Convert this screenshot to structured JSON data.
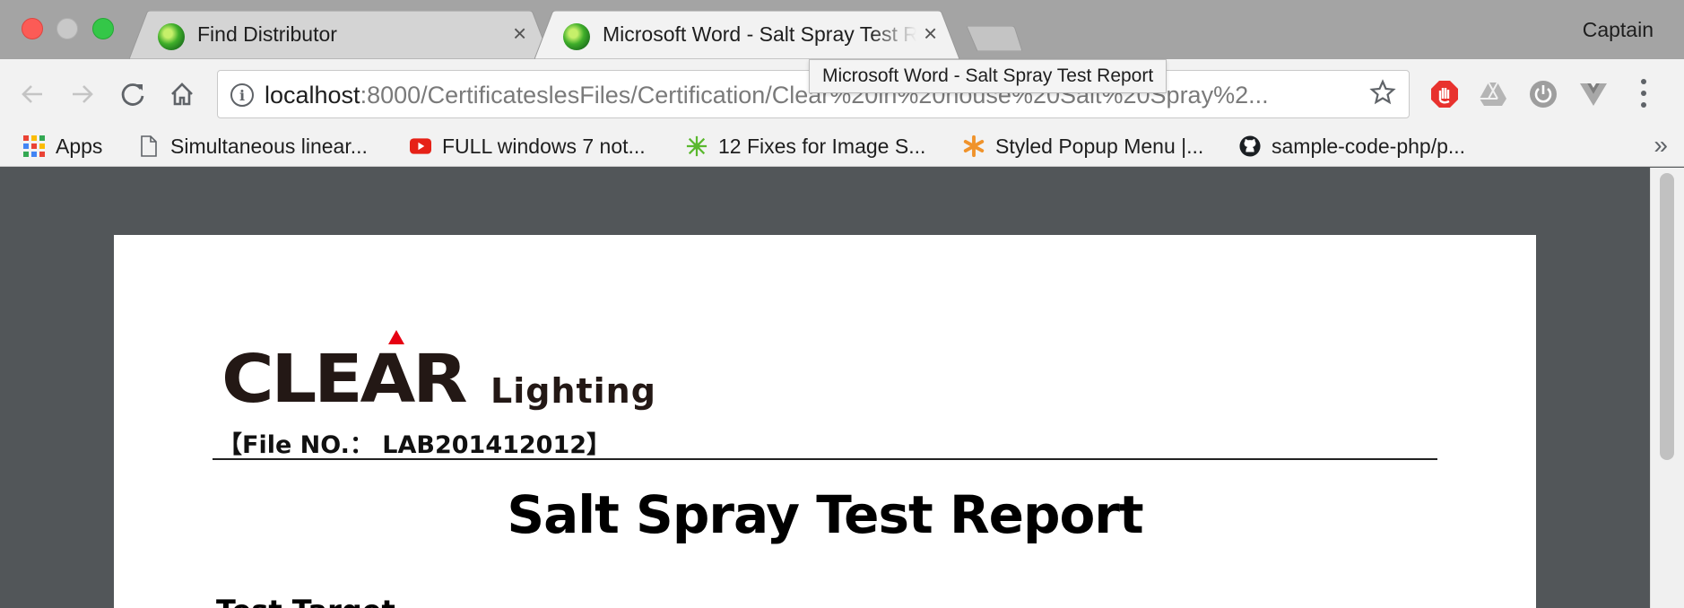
{
  "browser": {
    "tabs": [
      {
        "title": "Find Distributor",
        "close": "×"
      },
      {
        "title": "Microsoft Word - Salt Spray Test Report",
        "close": "×"
      }
    ],
    "profile": "Captain",
    "address": {
      "host": "localhost",
      "path": ":8000/CertificateslesFiles/Certification/Clear%20in%20house%20Salt%20Spray%2..."
    },
    "tooltip": "Microsoft Word - Salt Spray Test Report",
    "icons": {
      "back": "arrow-back",
      "forward": "arrow-forward",
      "reload": "reload",
      "home": "home",
      "info": "info",
      "star": "star",
      "ext_adblock": "stop-hand",
      "ext_drive": "drive",
      "ext_power": "power",
      "ext_vue": "vue",
      "menu": "more-vertical"
    }
  },
  "bookmarks": {
    "apps": "Apps",
    "items": [
      {
        "label": "Simultaneous linear...",
        "icon": "page"
      },
      {
        "label": "FULL windows 7 not...",
        "icon": "youtube"
      },
      {
        "label": "12 Fixes for Image S...",
        "icon": "green-star"
      },
      {
        "label": "Styled Popup Menu |...",
        "icon": "orange-asterisk"
      },
      {
        "label": "sample-code-php/p...",
        "icon": "github"
      }
    ],
    "more": "»"
  },
  "document": {
    "logo_main": "CLEAR",
    "logo_sub": "Lighting",
    "file_no": "【File NO.： LAB201412012】",
    "title": "Salt Spray Test Report",
    "section": "Test Target"
  },
  "colors": {
    "logo_accent": "#e60012",
    "viewer_bg": "#525659"
  }
}
